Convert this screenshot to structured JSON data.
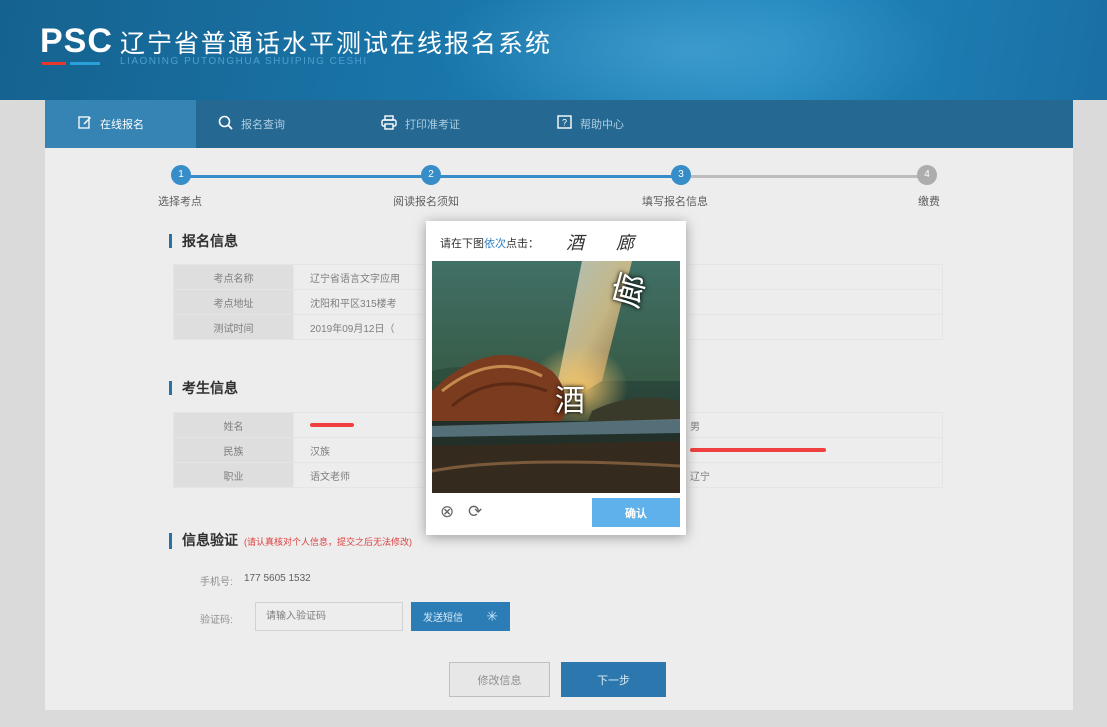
{
  "header": {
    "logo_text": "PSC",
    "title": "辽宁省普通话水平测试在线报名系统",
    "subtitle": "LIAONING PUTONGHUA SHUIPING CESHI"
  },
  "nav": {
    "items": [
      {
        "label": "在线报名",
        "icon": "edit-icon"
      },
      {
        "label": "报名查询",
        "icon": "search-icon"
      },
      {
        "label": "打印准考证",
        "icon": "printer-icon"
      },
      {
        "label": "帮助中心",
        "icon": "help-icon"
      }
    ]
  },
  "steps": [
    {
      "num": "1",
      "label": "选择考点"
    },
    {
      "num": "2",
      "label": "阅读报名须知"
    },
    {
      "num": "3",
      "label": "填写报名信息"
    },
    {
      "num": "4",
      "label": "缴费"
    }
  ],
  "registration": {
    "title": "报名信息",
    "rows": [
      {
        "label": "考点名称",
        "value": "辽宁省语言文字应用"
      },
      {
        "label": "考点地址",
        "value": "沈阳和平区315楼考"
      },
      {
        "label": "测试时间",
        "value": "2019年09月12日（"
      }
    ]
  },
  "candidate": {
    "title": "考生信息",
    "rows": [
      {
        "label": "姓名",
        "value": "",
        "label2": "",
        "value2": "男"
      },
      {
        "label": "民族",
        "value": "汉族",
        "label2": "",
        "value2": ""
      },
      {
        "label": "职业",
        "value": "语文老师",
        "label2": "",
        "value2": "辽宁"
      }
    ]
  },
  "verify": {
    "title": "信息验证",
    "note": "(请认真核对个人信息，提交之后无法修改)",
    "phone_label": "手机号:",
    "phone_value": "177 5605 1532",
    "code_label": "验证码:",
    "code_placeholder": "请输入验证码",
    "send_label": "发送短信"
  },
  "buttons": {
    "edit": "修改信息",
    "next": "下一步"
  },
  "captcha": {
    "prompt_prefix": "请在下图",
    "prompt_highlight": "依次",
    "prompt_suffix": "点击：",
    "targets": [
      "酒",
      "廊"
    ],
    "image_chars": [
      "酒",
      "廊"
    ],
    "confirm_label": "确认"
  }
}
